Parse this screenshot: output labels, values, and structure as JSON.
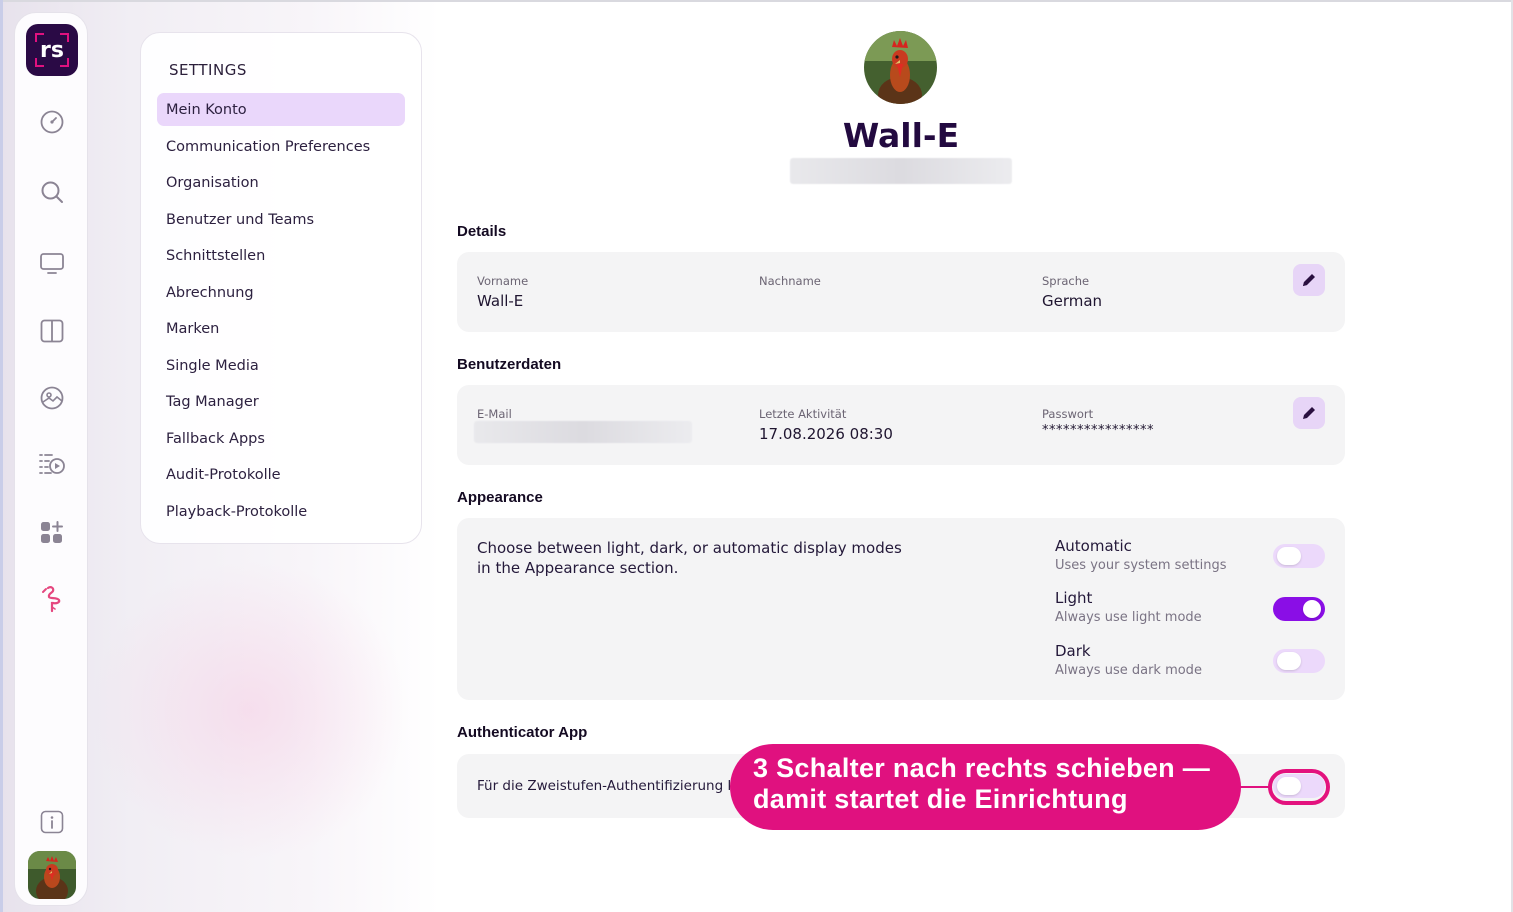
{
  "sidebar_rail": {
    "logo_text": "rs",
    "icons": [
      "dashboard-icon",
      "search-icon",
      "screen-icon",
      "layout-icon",
      "media-icon",
      "playlist-icon",
      "apps-add-icon",
      "flamingo-icon",
      "info-icon"
    ]
  },
  "settings_nav": {
    "title": "SETTINGS",
    "items": [
      {
        "label": "Mein Konto",
        "active": true
      },
      {
        "label": "Communication Preferences"
      },
      {
        "label": "Organisation"
      },
      {
        "label": "Benutzer und Teams"
      },
      {
        "label": "Schnittstellen"
      },
      {
        "label": "Abrechnung"
      },
      {
        "label": "Marken"
      },
      {
        "label": "Single Media"
      },
      {
        "label": "Tag Manager"
      },
      {
        "label": "Fallback Apps"
      },
      {
        "label": "Audit-Protokolle"
      },
      {
        "label": "Playback-Protokolle"
      }
    ]
  },
  "profile": {
    "name": "Wall-E"
  },
  "details": {
    "title": "Details",
    "first_name_label": "Vorname",
    "first_name": "Wall-E",
    "last_name_label": "Nachname",
    "last_name": "",
    "language_label": "Sprache",
    "language": "German"
  },
  "user_data": {
    "title": "Benutzerdaten",
    "email_label": "E-Mail",
    "last_activity_label": "Letzte Aktivität",
    "last_activity": "17.08.2026 08:30",
    "password_label": "Passwort",
    "password": "****************"
  },
  "appearance": {
    "title": "Appearance",
    "description_line1": "Choose between light, dark, or automatic display modes",
    "description_line2": "in the Appearance section.",
    "options": [
      {
        "title": "Automatic",
        "subtitle": "Uses your system settings",
        "enabled": false
      },
      {
        "title": "Light",
        "subtitle": "Always use light mode",
        "enabled": true
      },
      {
        "title": "Dark",
        "subtitle": "Always use dark mode",
        "enabled": false
      }
    ]
  },
  "authenticator": {
    "title": "Authenticator App",
    "description": "Für die Zweistufen-Authentifizierung ka",
    "enabled": false
  },
  "callout": {
    "line1": "3  Schalter nach rechts schieben —",
    "line2": "damit startet die Einrichtung"
  },
  "colors": {
    "accent": "#8a0ee6",
    "callout": "#e0117f",
    "nav_active": "#ead7fb",
    "heading": "#230a40"
  }
}
